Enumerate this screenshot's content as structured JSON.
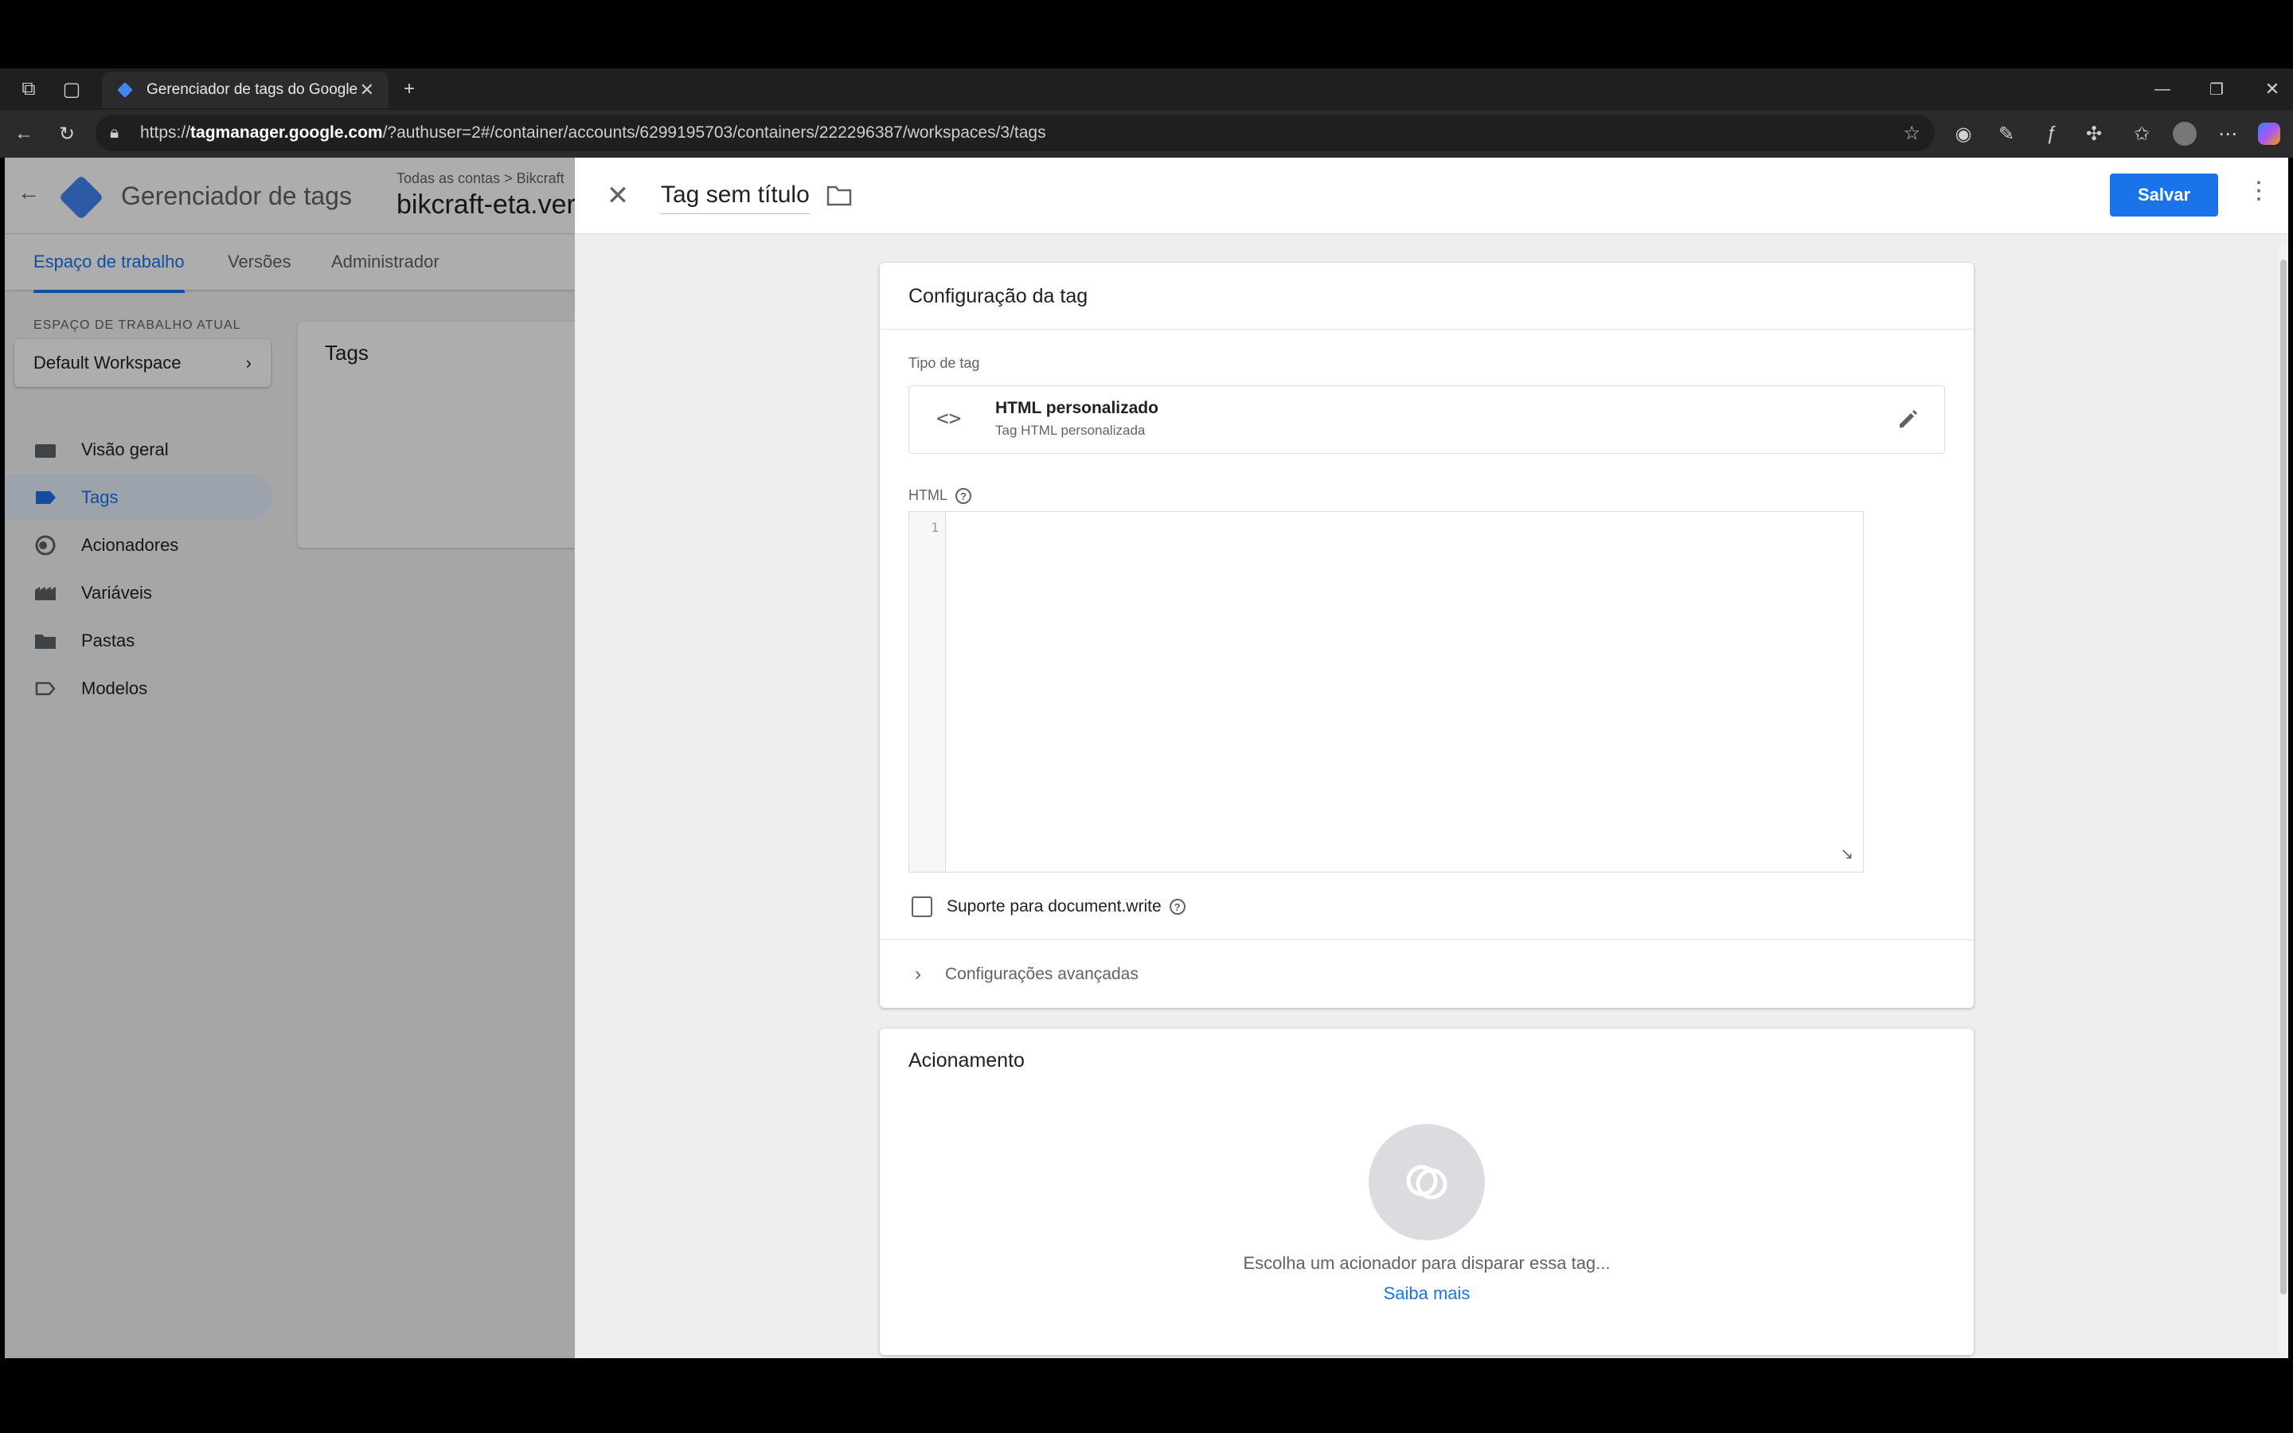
{
  "browser": {
    "tab_title": "Gerenciador de tags do Google",
    "url_prefix": "https://",
    "url_host": "tagmanager.google.com",
    "url_path": "/?authuser=2#/container/accounts/6299195703/containers/222296387/workspaces/3/tags"
  },
  "app": {
    "title": "Gerenciador de tags",
    "breadcrumb": "Todas as contas  >  Bikcraft",
    "container_name": "bikcraft-eta.ver",
    "tabs": [
      "Espaço de trabalho",
      "Versões",
      "Administrador"
    ],
    "workspace_label": "ESPAÇO DE TRABALHO ATUAL",
    "workspace_name": "Default Workspace",
    "nav": [
      "Visão geral",
      "Tags",
      "Acionadores",
      "Variáveis",
      "Pastas",
      "Modelos"
    ],
    "tags_card_title": "Tags"
  },
  "panel": {
    "tag_title": "Tag sem título",
    "save_label": "Salvar",
    "config_title": "Configuração da tag",
    "type_label": "Tipo de tag",
    "type_name": "HTML personalizado",
    "type_sub": "Tag HTML personalizada",
    "html_label": "HTML",
    "line_number": "1",
    "docwrite_label": "Suporte para document.write",
    "advanced_label": "Configurações avançadas",
    "trigger_title": "Acionamento",
    "trigger_hint": "Escolha um acionador para disparar essa tag...",
    "learn_more": "Saiba mais"
  },
  "colors": {
    "accent": "#1a73e8",
    "overlay": "rgba(0,0,0,0.32)"
  }
}
